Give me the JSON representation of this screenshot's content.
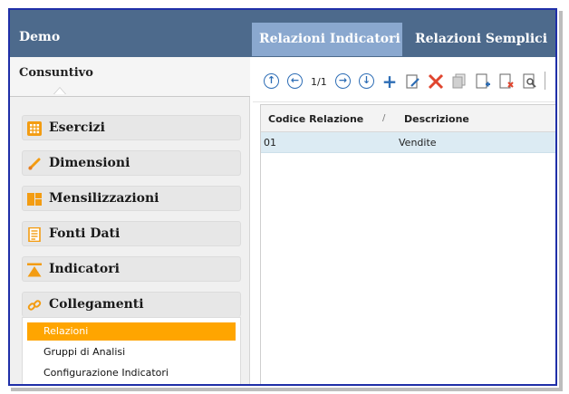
{
  "header": {
    "app_title": "Demo",
    "tabs": [
      {
        "label": "Relazioni Indicatori",
        "active": true
      },
      {
        "label": "Relazioni Semplici",
        "active": false
      }
    ]
  },
  "sidebar": {
    "title": "Consuntivo",
    "sections": [
      {
        "label": "Esercizi",
        "icon": "grid-icon"
      },
      {
        "label": "Dimensioni",
        "icon": "pencil-icon"
      },
      {
        "label": "Mensilizzazioni",
        "icon": "layout-icon"
      },
      {
        "label": "Fonti Dati",
        "icon": "document-icon"
      },
      {
        "label": "Indicatori",
        "icon": "indicator-icon"
      },
      {
        "label": "Collegamenti",
        "icon": "link-icon"
      }
    ],
    "sub_items": [
      {
        "label": "Relazioni",
        "selected": true
      },
      {
        "label": "Gruppi di Analisi",
        "selected": false
      },
      {
        "label": "Configurazione Indicatori",
        "selected": false
      }
    ]
  },
  "toolbar": {
    "pager": "1/1",
    "icons": [
      "first-page-icon",
      "prev-page-icon",
      "next-page-icon",
      "last-page-icon",
      "add-icon",
      "edit-icon",
      "delete-icon",
      "copy-icon",
      "new-document-icon",
      "remove-document-icon",
      "preview-icon"
    ]
  },
  "grid": {
    "columns": [
      "Codice Relazione",
      "Descrizione"
    ],
    "sort_indicator": "/",
    "rows": [
      {
        "codice": "01",
        "descrizione": "Vendite"
      }
    ]
  },
  "colors": {
    "topbar": "#4d6a8c",
    "active_tab": "#8aa8cf",
    "selected_item": "#ffa500",
    "accent_icons": "#2d6db5",
    "delete": "#e0452e",
    "row_highlight": "#dcebf3",
    "frame": "#1f2fa8"
  }
}
